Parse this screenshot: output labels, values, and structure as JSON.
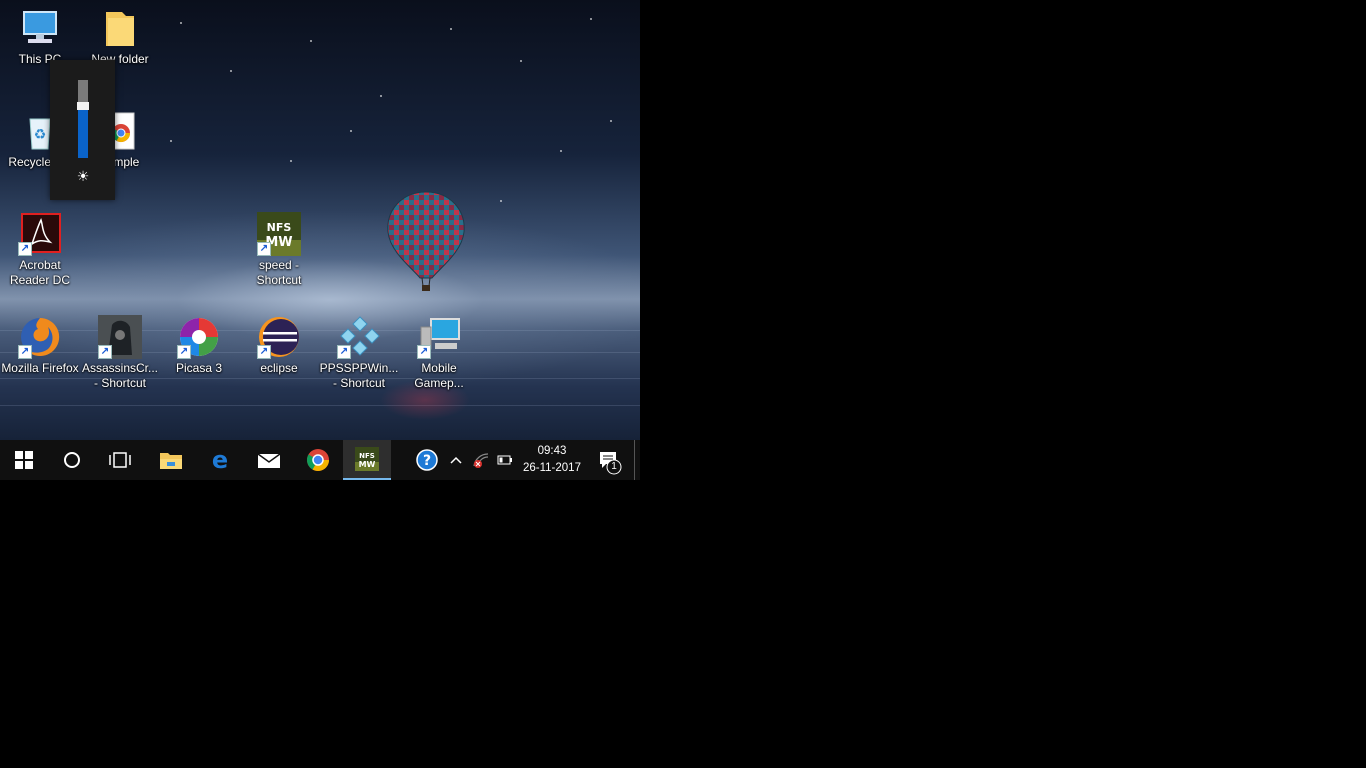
{
  "desktop_icons": [
    {
      "label": "This PC",
      "icon": "this-pc-icon",
      "shortcut": false
    },
    {
      "label": "New folder",
      "icon": "folder-icon",
      "shortcut": false
    },
    {
      "label": "Recycle Bin",
      "icon": "recycle-bin-icon",
      "shortcut": false
    },
    {
      "label": "sample",
      "icon": "chrome-document-icon",
      "shortcut": false
    },
    {
      "label": "Acrobat\nReader DC",
      "icon": "acrobat-icon",
      "shortcut": true
    },
    {
      "label": "speed -\nShortcut",
      "icon": "nfs-mw-icon",
      "shortcut": true
    },
    {
      "label": "Mozilla Firefox",
      "icon": "firefox-icon",
      "shortcut": true
    },
    {
      "label": "AssassinsCr...\n- Shortcut",
      "icon": "assassins-creed-icon",
      "shortcut": true
    },
    {
      "label": "Picasa 3",
      "icon": "picasa-icon",
      "shortcut": true
    },
    {
      "label": "eclipse",
      "icon": "eclipse-icon",
      "shortcut": true
    },
    {
      "label": "PPSSPPWin...\n- Shortcut",
      "icon": "ppsspp-icon",
      "shortcut": true
    },
    {
      "label": "Mobile\nGamep...",
      "icon": "mobile-gamepad-icon",
      "shortcut": true
    }
  ],
  "brightness": {
    "level": 0.62,
    "icon": "brightness-sun-icon"
  },
  "taskbar": {
    "buttons": [
      {
        "name": "start-button",
        "icon": "windows-logo-icon"
      },
      {
        "name": "cortana-button",
        "icon": "cortana-circle-icon"
      },
      {
        "name": "task-view-button",
        "icon": "task-view-icon"
      },
      {
        "name": "file-explorer-button",
        "icon": "file-explorer-icon"
      },
      {
        "name": "edge-button",
        "icon": "edge-icon"
      },
      {
        "name": "mail-button",
        "icon": "mail-icon"
      },
      {
        "name": "chrome-button",
        "icon": "chrome-icon"
      },
      {
        "name": "nfs-mw-taskbar-button",
        "icon": "nfs-mw-icon",
        "active": true
      }
    ],
    "tray": {
      "help_icon": "help-icon",
      "chevron_icon": "chevron-up-icon",
      "network_icon": "network-disconnected-icon",
      "battery_icon": "battery-icon",
      "time": "09:43",
      "date": "26-11-2017",
      "notifications_badge": "1"
    }
  },
  "colors": {
    "accent": "#76b9ed",
    "taskbar": "#101010",
    "brightness_fill": "#0a63c9"
  }
}
